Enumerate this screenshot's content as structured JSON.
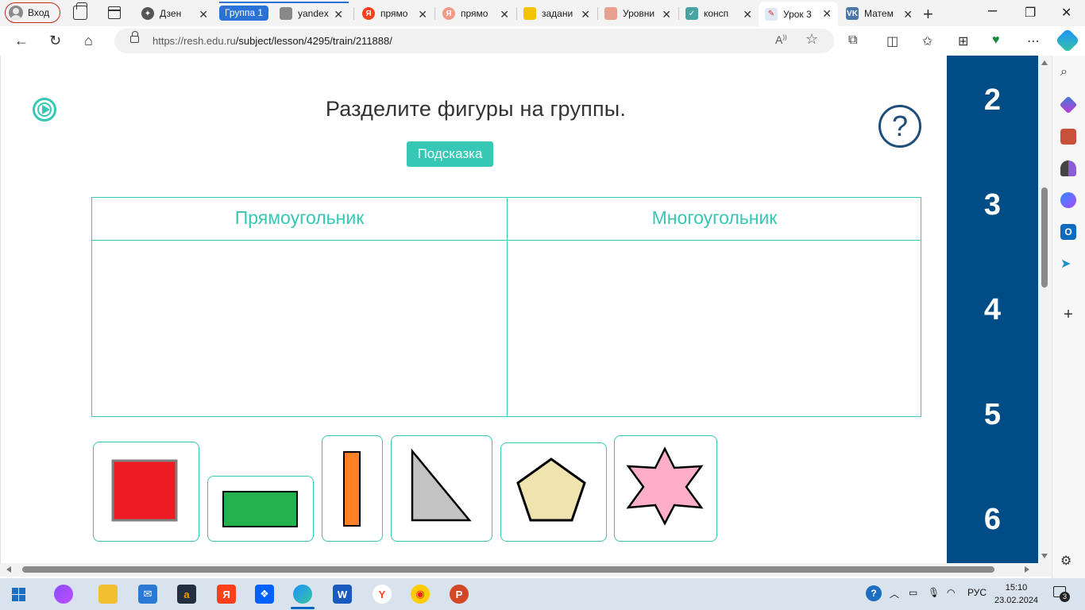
{
  "browser": {
    "profile_label": "Вход",
    "tab_group_label": "Группа 1",
    "tabs": [
      {
        "label": "Дзен"
      },
      {
        "label": "yandex"
      },
      {
        "label": "прямо"
      },
      {
        "label": "прямо"
      },
      {
        "label": "задани"
      },
      {
        "label": "Уровни"
      },
      {
        "label": "консп"
      },
      {
        "label": "Урок 3"
      },
      {
        "label": "Матем"
      }
    ],
    "url_host": "https://resh.edu.ru",
    "url_path": "/subject/lesson/4295/train/211888/"
  },
  "task": {
    "title": "Разделите фигуры на группы.",
    "hint_label": "Подсказка",
    "help_label": "?"
  },
  "groups": {
    "left_header": "Прямоугольник",
    "right_header": "Многоугольник"
  },
  "shapes": [
    {
      "name": "red-square",
      "fill": "#ed1c24",
      "stroke": "#7f7f7f"
    },
    {
      "name": "green-rectangle",
      "fill": "#22b14c",
      "stroke": "#000000"
    },
    {
      "name": "orange-rectangle",
      "fill": "#ff7f27",
      "stroke": "#000000"
    },
    {
      "name": "gray-triangle",
      "fill": "#c3c3c3",
      "stroke": "#000000"
    },
    {
      "name": "beige-pentagon",
      "fill": "#efe4b0",
      "stroke": "#000000"
    },
    {
      "name": "pink-star",
      "fill": "#ffaec9",
      "stroke": "#000000"
    }
  ],
  "side_nav": {
    "numbers": [
      "2",
      "3",
      "4",
      "5",
      "6"
    ]
  },
  "taskbar": {
    "language": "РУС",
    "time": "15:10",
    "date": "23.02.2024",
    "notifications": "3"
  },
  "colors": {
    "accent": "#37c8b5",
    "nav_panel": "#004c87",
    "help_icon": "#1e4e7b"
  }
}
